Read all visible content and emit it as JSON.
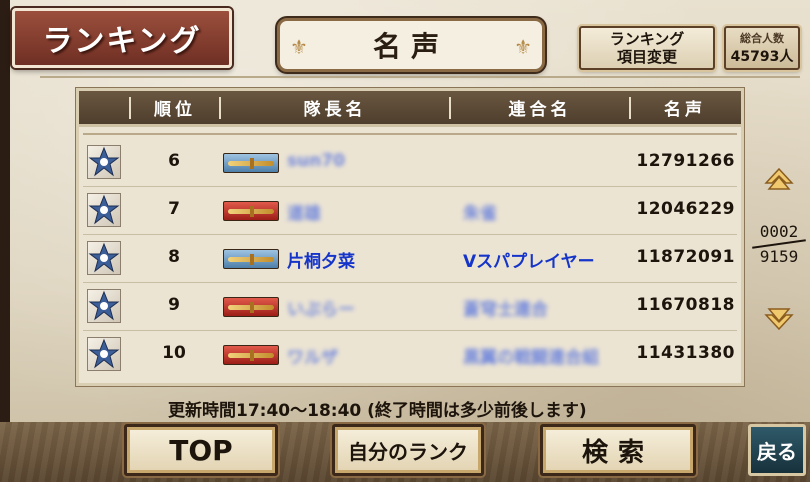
{
  "header": {
    "title": "ランキング",
    "tab_label": "名声",
    "change_items_label_line1": "ランキング",
    "change_items_label_line2": "項目変更",
    "total_label": "総合人数",
    "total_value": "45793人"
  },
  "table": {
    "columns": [
      "順位",
      "隊長名",
      "連合名",
      "名声"
    ],
    "rows": [
      {
        "rank": "6",
        "captain": "sun70",
        "alliance": "",
        "fame": "12791266",
        "tag": "blue"
      },
      {
        "rank": "7",
        "captain": "道雄",
        "alliance": "朱雀",
        "fame": "12046229",
        "tag": "red"
      },
      {
        "rank": "8",
        "captain": "片桐夕菜",
        "alliance": "Vスパプレイヤー",
        "fame": "11872091",
        "tag": "blue"
      },
      {
        "rank": "9",
        "captain": "いぶらー",
        "alliance": "蒼穹士連合",
        "fame": "11670818",
        "tag": "red"
      },
      {
        "rank": "10",
        "captain": "ワルザ",
        "alliance": "黒翼の戦闘連合組",
        "fame": "11431380",
        "tag": "red"
      }
    ]
  },
  "pager": {
    "current": "0002",
    "total": "9159"
  },
  "notice": "更新時間17:40～18:40 (終了時間は多少前後します)",
  "buttons": {
    "top": "TOP",
    "my_rank": "自分のランク",
    "search": "検索",
    "back": "戻る"
  },
  "icons": {
    "up": "up-arrow-icon",
    "down": "down-arrow-icon",
    "emblem": "star-emblem-icon"
  }
}
